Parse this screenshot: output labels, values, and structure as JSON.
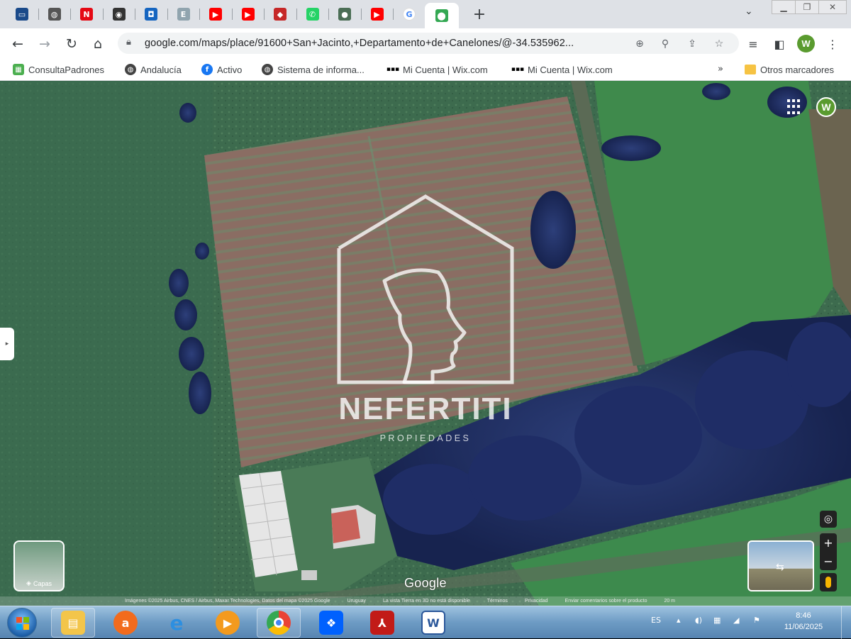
{
  "browser": {
    "tabs": [
      {
        "icon": "tv-icon",
        "color": "#1a4a8a",
        "glyph": "▭"
      },
      {
        "icon": "globe-icon",
        "color": "#555555",
        "glyph": "◍"
      },
      {
        "icon": "netflix-icon",
        "color": "#e50914",
        "glyph": "N"
      },
      {
        "icon": "soccer-ball-icon",
        "color": "#333333",
        "glyph": "◉"
      },
      {
        "icon": "shield-icon",
        "color": "#1565c0",
        "glyph": "◘"
      },
      {
        "icon": "document-icon",
        "color": "#90a4ae",
        "glyph": "E"
      },
      {
        "icon": "youtube-icon",
        "color": "#ff0000",
        "glyph": "▶"
      },
      {
        "icon": "youtube-icon",
        "color": "#ff0000",
        "glyph": "▶"
      },
      {
        "icon": "badge-icon",
        "color": "#c62828",
        "glyph": "◆"
      },
      {
        "icon": "whatsapp-icon",
        "color": "#25d366",
        "glyph": "✆"
      },
      {
        "icon": "globe-icon",
        "color": "#4b6e55",
        "glyph": "●"
      },
      {
        "icon": "youtube-icon",
        "color": "#ff0000",
        "glyph": "▶"
      },
      {
        "icon": "google-icon",
        "color": "#ffffff",
        "glyph": "G"
      },
      {
        "icon": "maps-pin-icon",
        "color": "#34a853",
        "glyph": "⬤",
        "active": true
      }
    ],
    "new_tab_label": "+",
    "url": "google.com/maps/place/91600+San+Jacinto,+Departamento+de+Canelones/@-34.535962...",
    "profile_initial": "W",
    "bookmarks": [
      {
        "label": "ConsultaPadrones",
        "icon": "padrones-icon",
        "color": "#4caf50"
      },
      {
        "label": "Andalucía",
        "icon": "globe-icon",
        "color": "#444444"
      },
      {
        "label": "Activo",
        "icon": "facebook-icon",
        "color": "#1877f2"
      },
      {
        "label": "Sistema de informa...",
        "icon": "globe-icon",
        "color": "#444444"
      },
      {
        "label": "Mi Cuenta | Wix.com",
        "icon": "wix-icon",
        "color": "#000000"
      },
      {
        "label": "Mi Cuenta | Wix.com",
        "icon": "wix-icon",
        "color": "#000000"
      }
    ],
    "bookmarks_more": "»",
    "other_bookmarks": "Otros marcadores"
  },
  "map": {
    "profile_initial": "W",
    "layers_label": "Capas",
    "google_logo": "Google",
    "attribution": [
      "Imágenes ©2025 Airbus, CNES / Airbus, Maxar Technologies, Datos del mapa ©2025 Google",
      "Uruguay",
      "La vista Tierra en 3D no está disponible",
      "Términos",
      "Privacidad",
      "Enviar comentarios sobre el producto",
      "20 m"
    ],
    "zoom_in": "+",
    "zoom_out": "−",
    "watermark_title": "NEFERTITI",
    "watermark_subtitle": "PROPIEDADES"
  },
  "taskbar": {
    "language": "ES",
    "time": "8:46",
    "date": "11/06/2025"
  }
}
